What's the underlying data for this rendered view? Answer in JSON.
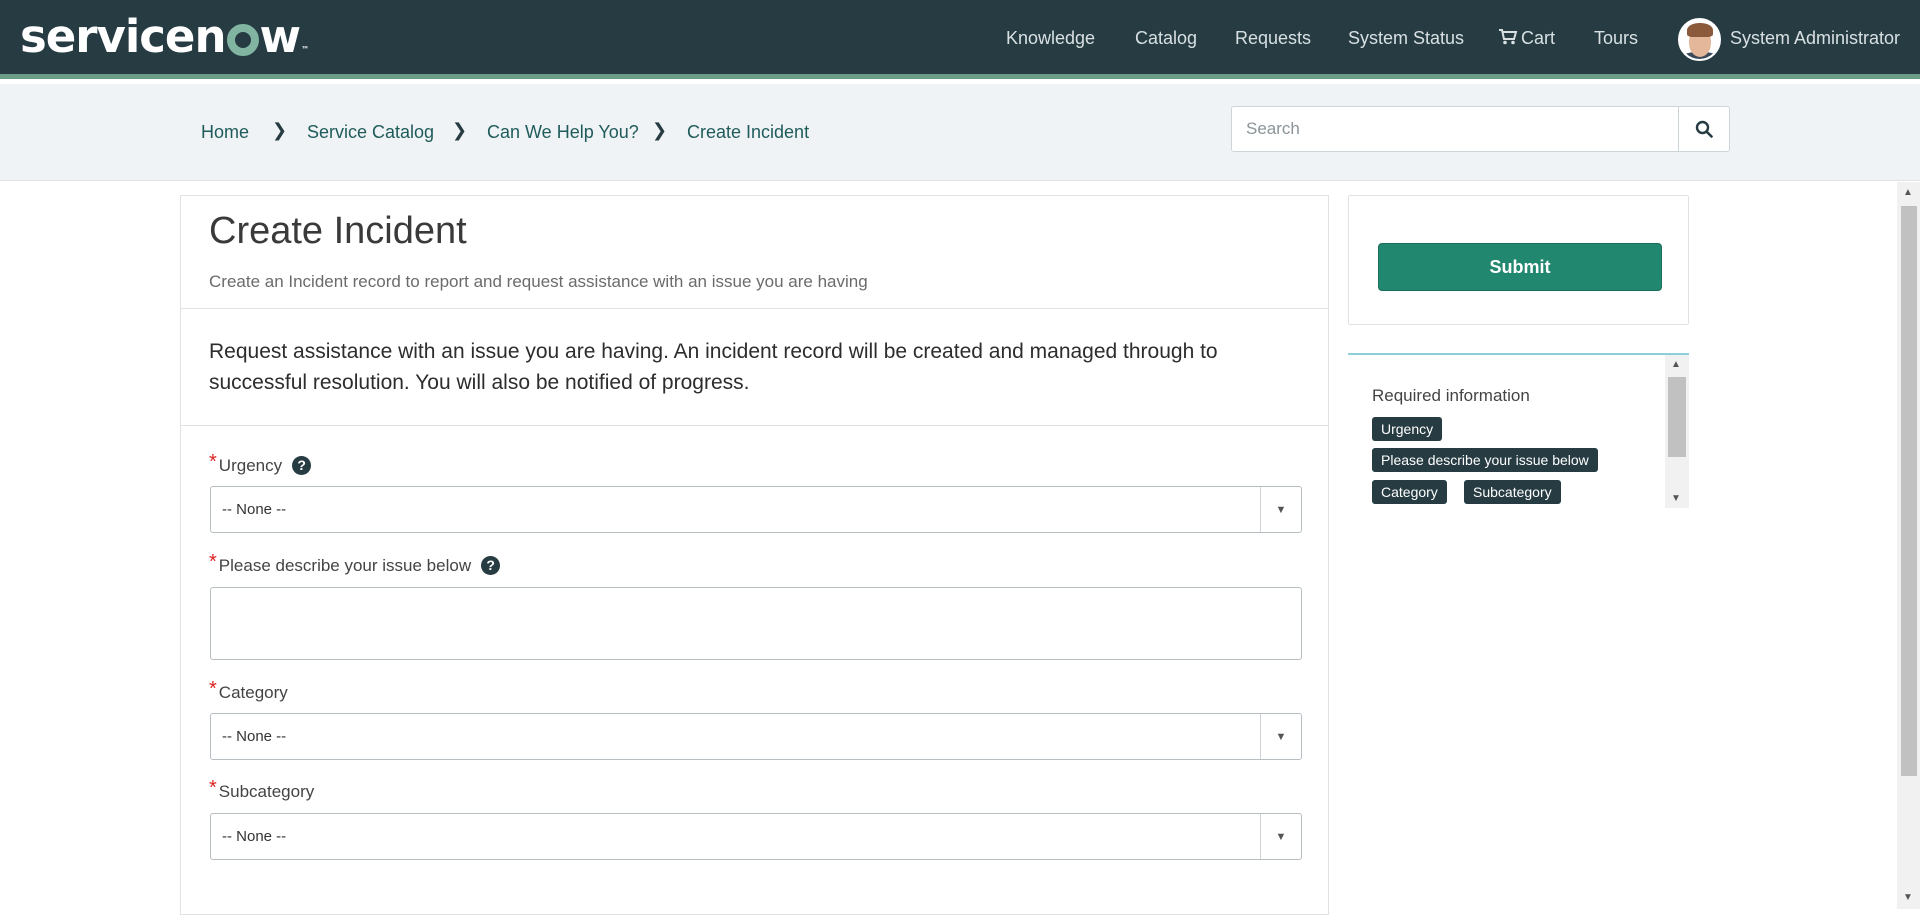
{
  "header": {
    "logo_text": "servicenow",
    "nav": [
      "Knowledge",
      "Catalog",
      "Requests",
      "System Status",
      "Cart",
      "Tours"
    ],
    "user_name": "System Administrator"
  },
  "breadcrumb": [
    "Home",
    "Service Catalog",
    "Can We Help You?",
    "Create Incident"
  ],
  "search": {
    "placeholder": "Search"
  },
  "form": {
    "title": "Create Incident",
    "subtitle": "Create an Incident record to report and request assistance with an issue you are having",
    "description": "Request assistance with an issue you are having. An incident record will be created and managed through to successful resolution. You will also be notified of progress.",
    "fields": {
      "urgency": {
        "label": "Urgency",
        "value": "-- None --"
      },
      "issue": {
        "label": "Please describe your issue below",
        "value": ""
      },
      "category": {
        "label": "Category",
        "value": "-- None --"
      },
      "subcategory": {
        "label": "Subcategory",
        "value": "-- None --"
      }
    }
  },
  "side": {
    "submit_label": "Submit",
    "required_title": "Required information",
    "required_tags": [
      "Urgency",
      "Please describe your issue below",
      "Category",
      "Subcategory"
    ]
  },
  "colors": {
    "header_bg": "#263b42",
    "accent": "#21876f",
    "link": "#1f5b5a"
  },
  "icons": [
    "search-icon",
    "cart-icon",
    "chevron-right-icon",
    "question-circle-icon",
    "dropdown-arrow-icon"
  ]
}
